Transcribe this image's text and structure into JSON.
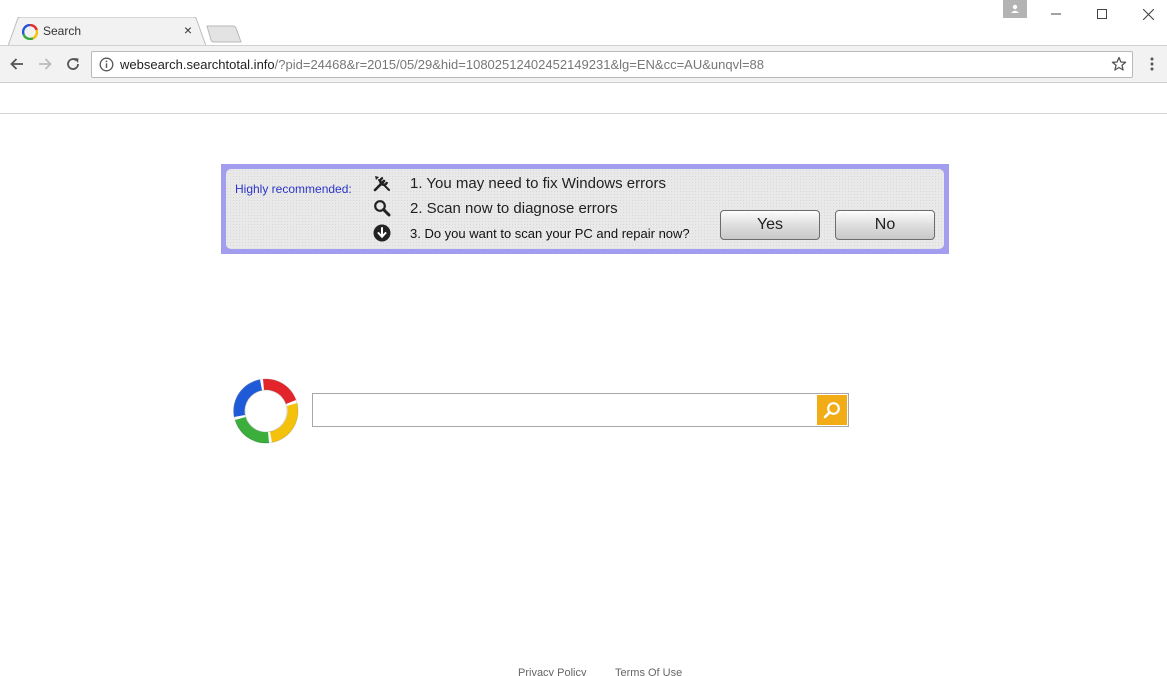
{
  "browser": {
    "tab_title": "Search",
    "tab_close": "×",
    "url_host": "websearch.searchtotal.info",
    "url_path": "/?pid=24468&r=2015/05/29&hid=10802512402452149231&lg=EN&cc=AU&unqvl=88"
  },
  "promo": {
    "label": "Highly recommended:",
    "items": [
      {
        "icon": "tools-icon",
        "text": "1. You may need to fix Windows errors"
      },
      {
        "icon": "magnifier-icon",
        "text": "2. Scan now to diagnose errors"
      },
      {
        "icon": "download-arrow-icon",
        "text": "3. Do you want to scan your PC and repair now?"
      }
    ],
    "yes_label": "Yes",
    "no_label": "No",
    "border_color": "#a39df0"
  },
  "search": {
    "value": "",
    "button_color": "#f2ac16"
  },
  "footer": {
    "privacy": "Privacy Policy",
    "terms": "Terms Of Use"
  }
}
